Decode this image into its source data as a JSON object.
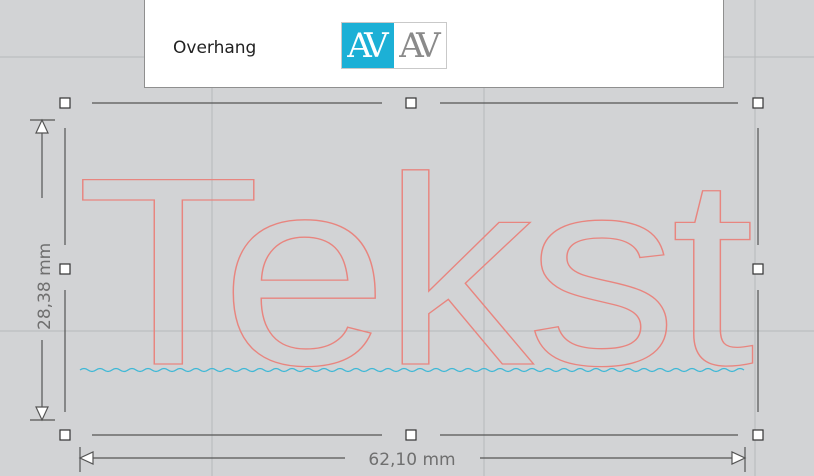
{
  "toolbar": {
    "overhang_label": "Overhang",
    "av_option_1": "AV",
    "av_option_2": "AV",
    "active_option": 1
  },
  "canvas": {
    "text_object": "Tekst",
    "height_dimension": "28,38 mm",
    "width_dimension": "62,10 mm"
  },
  "colors": {
    "outline": "#e8857f",
    "baseline": "#3fb8d6",
    "accent": "#1cb0d6"
  }
}
